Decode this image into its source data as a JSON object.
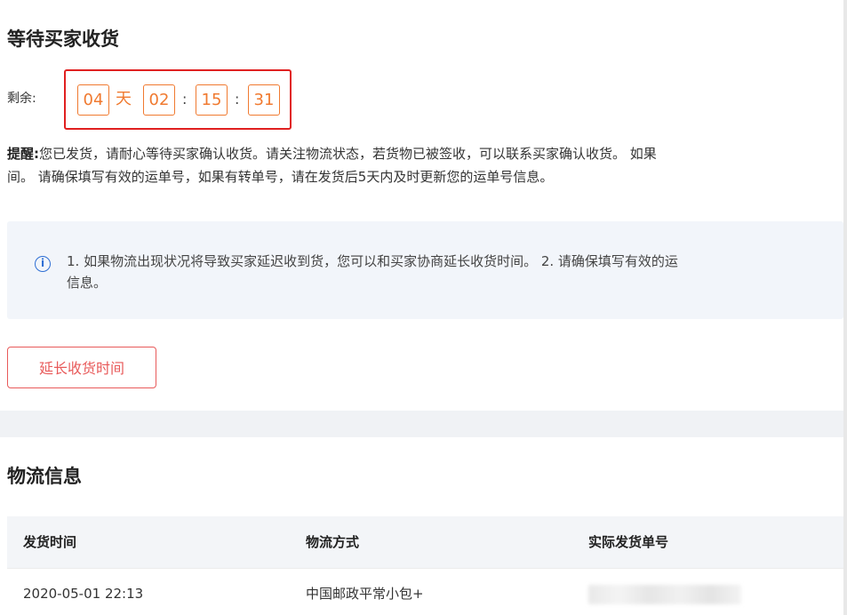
{
  "status": {
    "title": "等待买家收货",
    "remain_label": "剩余:",
    "countdown": {
      "days": "04",
      "day_unit": "天",
      "hours": "02",
      "minutes": "15",
      "seconds": "31",
      "colon": ":"
    },
    "reminder_label": "提醒:",
    "reminder_text": "您已发货，请耐心等待买家确认收货。请关注物流状态，若货物已被签收，可以联系买家确认收货。 如果",
    "reminder_text_line2": "间。 请确保填写有效的运单号，如果有转单号，请在发货后5天内及时更新您的运单号信息。",
    "notice_icon": "info-icon",
    "notice_text": "1. 如果物流出现状况将导致买家延迟收到货，您可以和买家协商延长收货时间。 2. 请确保填写有效的运",
    "notice_text_line2": "信息。",
    "extend_button": "延长收货时间",
    "accent_color": "#f07a30",
    "button_color": "#e85a5a"
  },
  "logistics": {
    "title": "物流信息",
    "columns": [
      "发货时间",
      "物流方式",
      "实际发货单号"
    ],
    "rows": [
      [
        "2020-05-01 22:13",
        "中国邮政平常小包+"
      ]
    ]
  }
}
